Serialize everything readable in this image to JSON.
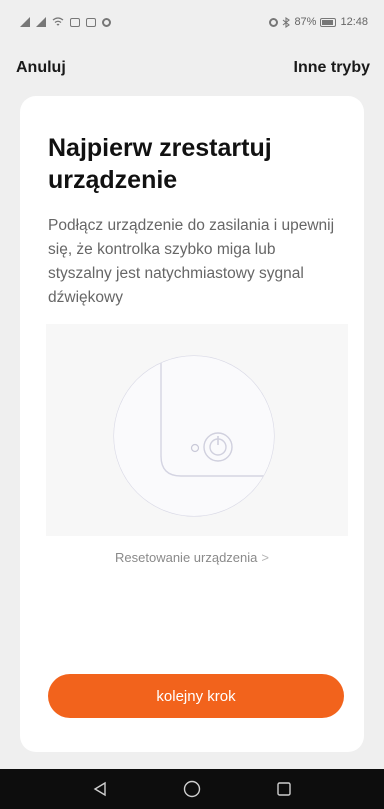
{
  "status_bar": {
    "battery": "87%",
    "time": "12:48",
    "icons": [
      "signal-icon",
      "signal-icon",
      "wifi-icon",
      "nfc-icon",
      "mail-icon",
      "sync-icon",
      "alarm-icon",
      "bluetooth-icon",
      "battery-icon"
    ]
  },
  "header": {
    "cancel_label": "Anuluj",
    "other_modes_label": "Inne tryby"
  },
  "card": {
    "title": "Najpierw zrestartuj urządzenie",
    "description": "Podłącz urządzenie do zasilania i upewnij się, że kontrolka szybko miga lub styszalny jest natychmiastowy sygnal dźwiękowy",
    "reset_link_label": "Resetowanie urządzenia",
    "reset_link_chevron": ">",
    "next_button_label": "kolejny krok"
  },
  "nav_bar": {
    "icons": [
      "back-icon",
      "home-icon",
      "recents-icon"
    ]
  },
  "colors": {
    "accent": "#f2631c",
    "background": "#efefef",
    "card": "#ffffff"
  }
}
